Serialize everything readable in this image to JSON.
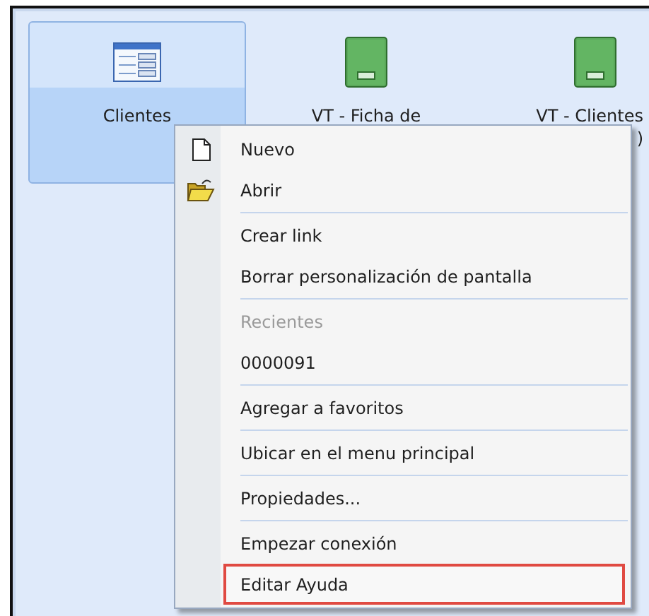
{
  "tiles": [
    {
      "kind": "form",
      "lines": [
        "Clientes"
      ],
      "selected": true
    },
    {
      "kind": "book",
      "lines": [
        "VT - Ficha de"
      ],
      "selected": false
    },
    {
      "kind": "book",
      "lines": [
        "VT - Clientes",
        ")"
      ],
      "selected": false
    }
  ],
  "context_menu": {
    "items": [
      {
        "kind": "item",
        "label": "Nuevo",
        "highlighted": false
      },
      {
        "kind": "item",
        "label": "Abrir",
        "highlighted": false
      },
      {
        "kind": "separator"
      },
      {
        "kind": "item",
        "label": "Crear link",
        "highlighted": false
      },
      {
        "kind": "item",
        "label": "Borrar personalización de pantalla",
        "highlighted": false
      },
      {
        "kind": "separator"
      },
      {
        "kind": "header",
        "label": "Recientes"
      },
      {
        "kind": "item",
        "label": "0000091",
        "highlighted": false
      },
      {
        "kind": "separator"
      },
      {
        "kind": "item",
        "label": "Agregar a favoritos",
        "highlighted": false
      },
      {
        "kind": "separator"
      },
      {
        "kind": "item",
        "label": "Ubicar en el menu principal",
        "highlighted": false
      },
      {
        "kind": "separator"
      },
      {
        "kind": "item",
        "label": "Propiedades...",
        "highlighted": false
      },
      {
        "kind": "separator"
      },
      {
        "kind": "item",
        "label": "Empezar conexión",
        "highlighted": false
      },
      {
        "kind": "item",
        "label": "Editar Ayuda",
        "highlighted": true
      }
    ]
  }
}
